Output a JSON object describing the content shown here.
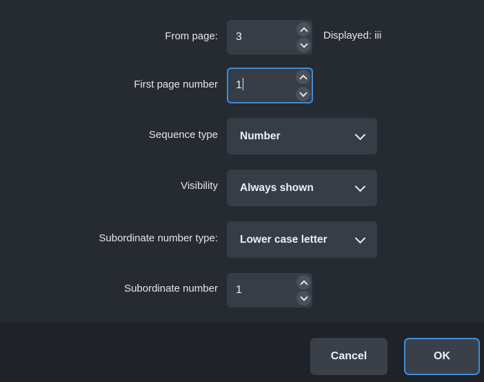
{
  "fields": {
    "from_page": {
      "label": "From page:",
      "value": "3",
      "displayed": "Displayed: iii"
    },
    "first_page_number": {
      "label": "First page number",
      "value": "1"
    },
    "sequence_type": {
      "label": "Sequence type",
      "value": "Number"
    },
    "visibility": {
      "label": "Visibility",
      "value": "Always shown"
    },
    "subordinate_number_type": {
      "label": "Subordinate number type:",
      "value": "Lower case letter"
    },
    "subordinate_number": {
      "label": "Subordinate number",
      "value": "1"
    }
  },
  "buttons": {
    "cancel": "Cancel",
    "ok": "OK"
  },
  "colors": {
    "accent": "#3f8fd6",
    "field_bg": "#373d47",
    "dialog_bg": "#262a31",
    "footer_bg": "#1f2228"
  }
}
